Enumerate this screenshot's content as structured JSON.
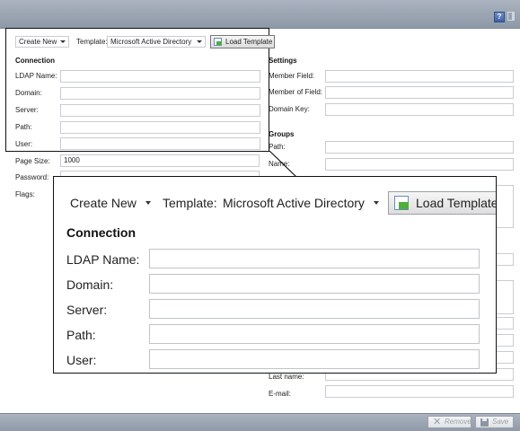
{
  "toolbar": {
    "help_label": "?"
  },
  "controls": {
    "create_value": "Create New",
    "template_label": "Template:",
    "template_value": "Microsoft Active Directory",
    "load_template_label": "Load Template"
  },
  "connection": {
    "title": "Connection",
    "ldap_name_label": "LDAP Name:",
    "domain_label": "Domain:",
    "server_label": "Server:",
    "path_label": "Path:",
    "user_label": "User:",
    "page_size_label": "Page Size:",
    "page_size_value": "1000",
    "password_label": "Password:",
    "flags_label": "Flags:"
  },
  "settings": {
    "title": "Settings",
    "member_field_label": "Member Field:",
    "member_of_field_label": "Member of Field:",
    "domain_key_label": "Domain Key:"
  },
  "groups": {
    "title": "Groups",
    "path_label": "Path:",
    "name_label": "Name:"
  },
  "users": {
    "last_name_label": "Last name:",
    "email_label": "E-mail:"
  },
  "footer": {
    "remove_label": "Remove",
    "save_label": "Save"
  },
  "colors": {
    "bar": "#9aa4b2",
    "border": "#111111",
    "accent": "#4fae3a"
  }
}
